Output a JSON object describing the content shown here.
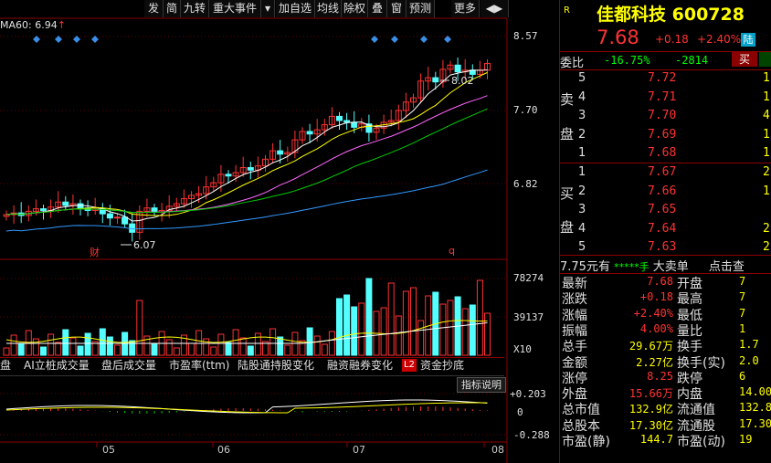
{
  "toolbar": {
    "buttons": [
      "发",
      "简",
      "九转",
      "重大事件",
      "▾",
      "加自选",
      "均线",
      "除权",
      "叠",
      "窗",
      "预测",
      "更多",
      "◀▶"
    ]
  },
  "chart": {
    "ma_label": "MA60: 6.94",
    "price_ticks": [
      "8.57",
      "7.70",
      "6.82"
    ],
    "high_marker": "8.02",
    "low_marker": "6.07",
    "badge_cai": "财",
    "badge_q": "q",
    "volume_ticks": [
      "78274",
      "39137",
      "X10"
    ],
    "indicator_tabs": [
      "盘",
      "AI立桩成交量",
      "盘后成交量",
      "市盈率(ttm)",
      "陆股通持股变化",
      "融资融券变化",
      "资金抄底"
    ],
    "l2_badge": "L2",
    "indicator_help": "指标说明",
    "macd_ticks": [
      "+0.203",
      "0",
      "-0.288"
    ],
    "x_ticks": [
      "05",
      "06",
      "07",
      "08"
    ],
    "colors": {
      "up": "#ff3232",
      "down": "#54ffff",
      "ma5": "#ffffff",
      "ma10": "#ffff00",
      "ma20": "#ff66ff",
      "ma30": "#00cc00",
      "ma60": "#3399ff"
    }
  },
  "quote": {
    "badge": "R",
    "name": "佳都科技",
    "code": "600728",
    "price": "7.68",
    "change": "+0.18",
    "change_pct": "+2.40%",
    "market_tag": "陆",
    "ratio_label": "委比",
    "ratio_pct": "-16.75%",
    "ratio_diff": "-2814",
    "buy_btn": "买",
    "sell_side_label": [
      "卖",
      "盘"
    ],
    "buy_side_label": [
      "买",
      "盘"
    ],
    "asks": [
      {
        "level": "5",
        "price": "7.72",
        "vol": "1"
      },
      {
        "level": "4",
        "price": "7.71",
        "vol": "1"
      },
      {
        "level": "3",
        "price": "7.70",
        "vol": "4"
      },
      {
        "level": "2",
        "price": "7.69",
        "vol": "1"
      },
      {
        "level": "1",
        "price": "7.68",
        "vol": "1"
      }
    ],
    "bids": [
      {
        "level": "1",
        "price": "7.67",
        "vol": "2"
      },
      {
        "level": "2",
        "price": "7.66",
        "vol": "1"
      },
      {
        "level": "3",
        "price": "7.65",
        "vol": ""
      },
      {
        "level": "4",
        "price": "7.64",
        "vol": "2"
      },
      {
        "level": "5",
        "price": "7.63",
        "vol": "2"
      }
    ],
    "strip": {
      "price": "7.75元有",
      "stars": "*****手",
      "dadan": "大卖单",
      "click": "点击查"
    },
    "stats": [
      {
        "l": "最新",
        "v": "7.68",
        "vc": "red",
        "l2": "开盘",
        "v2": "7"
      },
      {
        "l": "涨跌",
        "v": "+0.18",
        "vc": "red",
        "l2": "最高",
        "v2": "7"
      },
      {
        "l": "涨幅",
        "v": "+2.40%",
        "vc": "red",
        "l2": "最低",
        "v2": "7"
      },
      {
        "l": "振幅",
        "v": "4.00%",
        "vc": "red",
        "l2": "量比",
        "v2": "1"
      },
      {
        "l": "总手",
        "v": "29.67万",
        "vc": "yellow",
        "l2": "换手",
        "v2": "1.7"
      },
      {
        "l": "金额",
        "v": "2.27亿",
        "vc": "yellow",
        "l2": "换手(实)",
        "v2": "2.0"
      },
      {
        "l": "涨停",
        "v": "8.25",
        "vc": "red",
        "l2": "跌停",
        "v2": "6"
      },
      {
        "l": "外盘",
        "v": "15.66万",
        "vc": "red",
        "l2": "内盘",
        "v2": "14.00"
      },
      {
        "l": "总市值",
        "v": "132.9亿",
        "vc": "yellow",
        "l2": "流通值",
        "v2": "132.8"
      },
      {
        "l": "总股本",
        "v": "17.30亿",
        "vc": "yellow",
        "l2": "流通股",
        "v2": "17.30"
      },
      {
        "l": "市盈(静)",
        "v": "144.7",
        "vc": "yellow",
        "l2": "市盈(动)",
        "v2": "19"
      }
    ]
  }
}
